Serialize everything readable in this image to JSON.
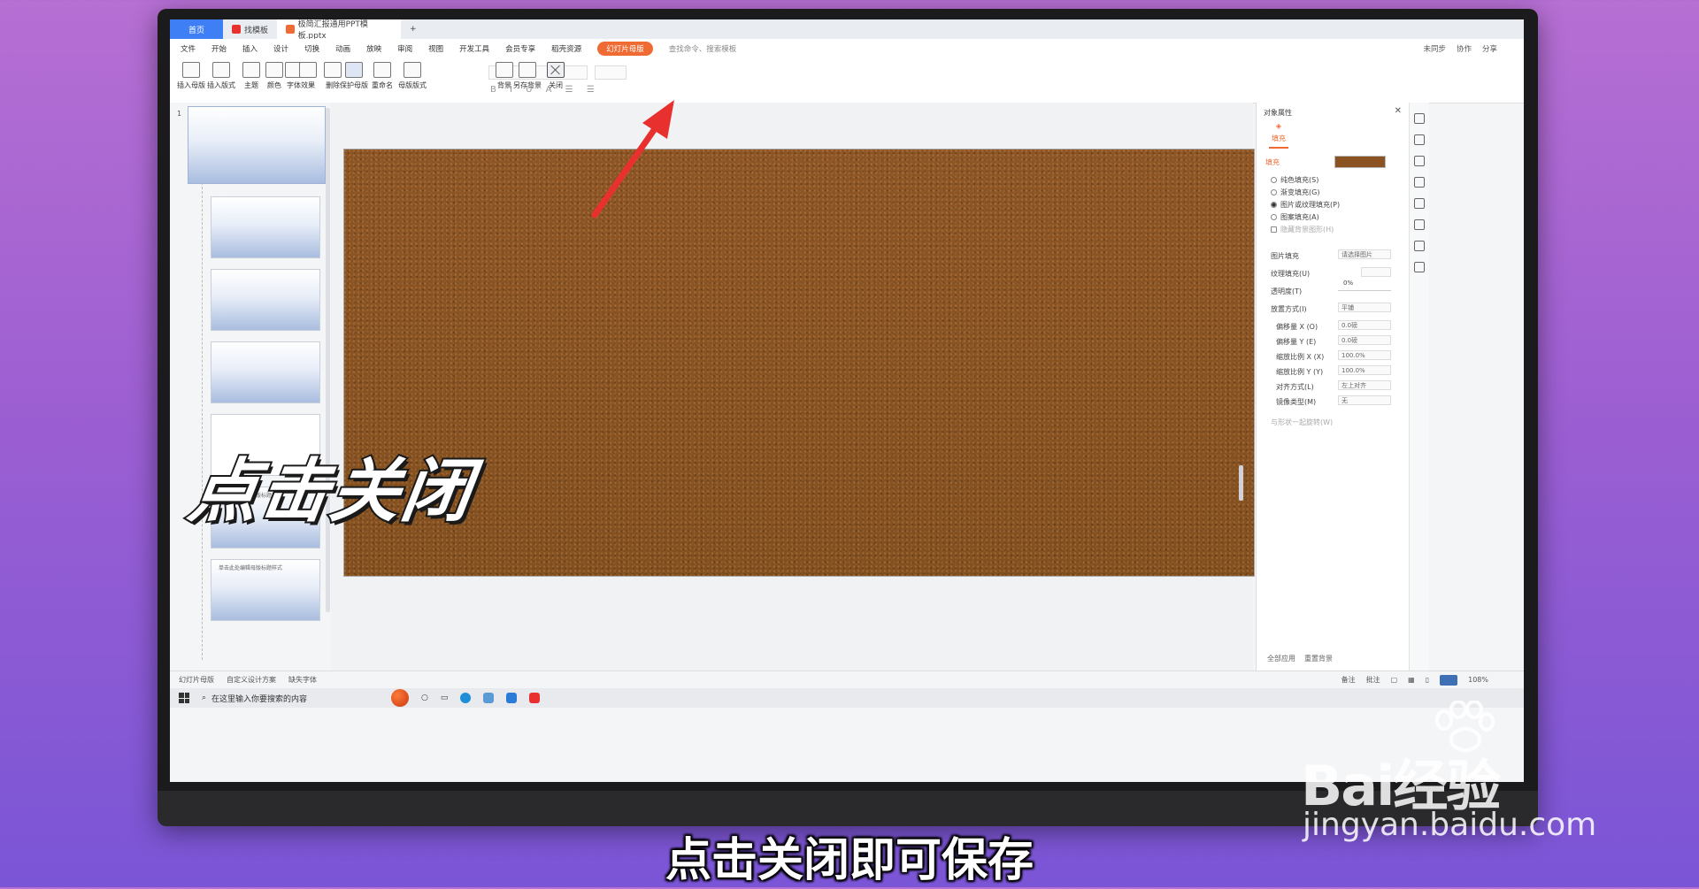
{
  "tabbar": {
    "home": "首页",
    "tab1": "找模板",
    "tab2": "极简汇报通用PPT模板.pptx",
    "plus": "+"
  },
  "menubar": {
    "file": "文件",
    "items": [
      "开始",
      "插入",
      "设计",
      "切换",
      "动画",
      "放映",
      "审阅",
      "视图",
      "开发工具",
      "会员专享",
      "稻壳资源"
    ],
    "active_pill": "幻灯片母版",
    "search": "查找命令、搜索模板",
    "right": [
      "未同步",
      "协作",
      "分享"
    ]
  },
  "ribbon": {
    "buttons": [
      "插入母版",
      "插入版式",
      "主题",
      "颜色",
      "字体",
      "效果",
      "删除",
      "保护母版",
      "重命名",
      "母版版式",
      "背景",
      "另存背景",
      "关闭"
    ]
  },
  "thumbs": {
    "number": "1",
    "slide_text": "单击此处编辑母版标题样式"
  },
  "pane": {
    "title": "对象属性",
    "tab": "填充",
    "fill_label": "填充",
    "options": [
      "纯色填充(S)",
      "渐变填充(G)",
      "图片或纹理填充(P)",
      "图案填充(A)",
      "隐藏背景图形(H)"
    ],
    "picture_fill": "图片填充",
    "picture_fill_value": "请选择图片",
    "texture_fill": "纹理填充(U)",
    "transparency": "透明度(T)",
    "transparency_value": "0%",
    "placement": "放置方式(I)",
    "placement_value": "平铺",
    "offset_x": "偏移量 X (O)",
    "offset_x_value": "0.0磅",
    "offset_y": "偏移量 Y (E)",
    "offset_y_value": "0.0磅",
    "scale_x": "缩放比例 X (X)",
    "scale_x_value": "100.0%",
    "scale_y": "缩放比例 Y (Y)",
    "scale_y_value": "100.0%",
    "align": "对齐方式(L)",
    "align_value": "左上对齐",
    "mirror": "镜像类型(M)",
    "mirror_value": "无",
    "rotate": "与形状一起旋转(W)",
    "apply_all": "全部应用",
    "reset": "重置背景"
  },
  "status": {
    "left": [
      "幻灯片母版",
      "自定义设计方案",
      "缺失字体"
    ],
    "notes": "备注",
    "comments": "批注",
    "zoom": "108%"
  },
  "taskbar": {
    "search": "在这里输入你要搜索的内容"
  },
  "overlay": {
    "big_text": "点击关闭",
    "caption": "点击关闭即可保存"
  },
  "watermark": {
    "logo": "Bai经验",
    "url": "jingyan.baidu.com"
  },
  "colors": {
    "accent": "#f06b34",
    "arrow": "#e8312f",
    "texture": "#8b5222"
  }
}
